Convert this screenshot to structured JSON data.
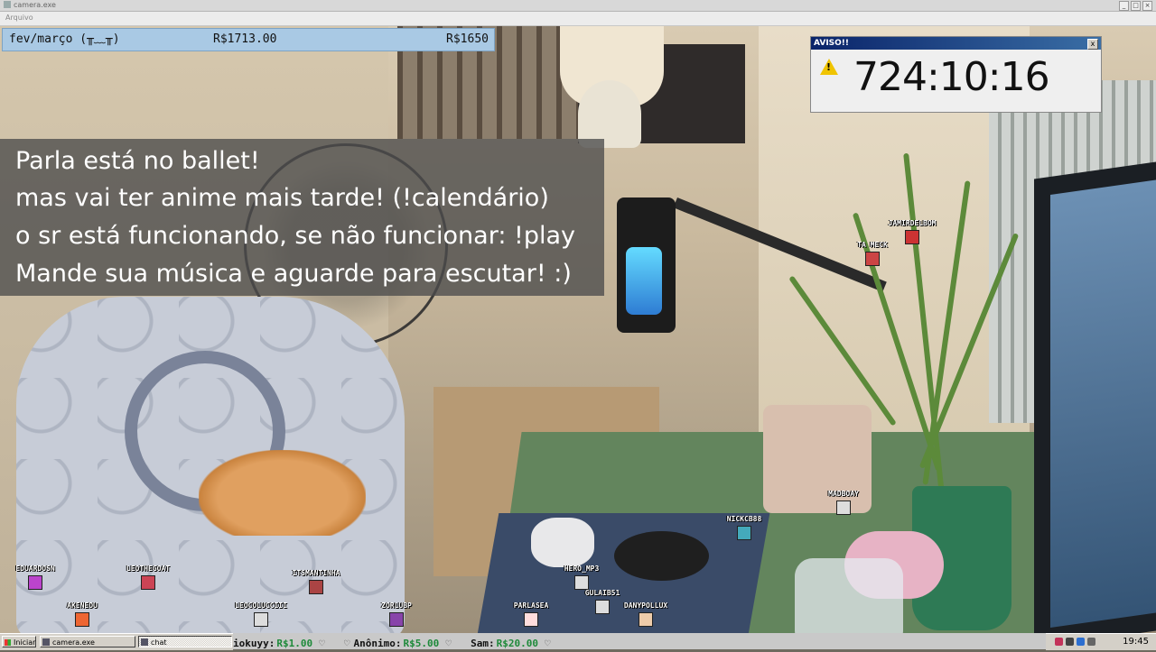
{
  "window": {
    "title": "camera.exe",
    "menu": "Arquivo"
  },
  "topbar": {
    "month": "fev/março (╥﹏╥)",
    "amount_current": "R$1713.00",
    "amount_goal": "R$1650"
  },
  "aviso": {
    "title": "AVISO!!",
    "timer": "724:10:16",
    "close": "x"
  },
  "message": {
    "lines": [
      "Parla está no ballet!",
      "mas vai ter anime mais tarde! (!calendário)",
      "o sr está funcionando, se não funcionar: !play",
      "Mande sua música e aguarde para escutar! :)"
    ]
  },
  "avatars": [
    {
      "name": "JAMIRDELBOM",
      "color": "#c33"
    },
    {
      "name": "TA MECK",
      "color": "#c44"
    },
    {
      "name": "MADBOAY",
      "color": "#ddd"
    },
    {
      "name": "NICKCB88",
      "color": "#4ab"
    },
    {
      "name": "EDUARDOSN",
      "color": "#b4c"
    },
    {
      "name": "LEOTHEGOAT",
      "color": "#c45"
    },
    {
      "name": "ITSMANTINHA",
      "color": "#a44"
    },
    {
      "name": "HERO_MP3",
      "color": "#ddd"
    },
    {
      "name": "GULAIB51",
      "color": "#ddd"
    },
    {
      "name": "AKENEDU",
      "color": "#e63"
    },
    {
      "name": "LEOCOLUCCIII",
      "color": "#ddd"
    },
    {
      "name": "ZORLUBP",
      "color": "#84a"
    },
    {
      "name": "PARLASEA",
      "color": "#fdd"
    },
    {
      "name": "DANYPOLLUX",
      "color": "#eca"
    }
  ],
  "ticker": [
    {
      "name": "iokuyy:",
      "amount": "R$1.00"
    },
    {
      "name": "Anônimo:",
      "amount": "R$5.00"
    },
    {
      "name": "Sam:",
      "amount": "R$20.00"
    }
  ],
  "taskbar": {
    "start": "Iniciar",
    "tasks": [
      "camera.exe",
      "chat"
    ],
    "clock": "19:45"
  }
}
